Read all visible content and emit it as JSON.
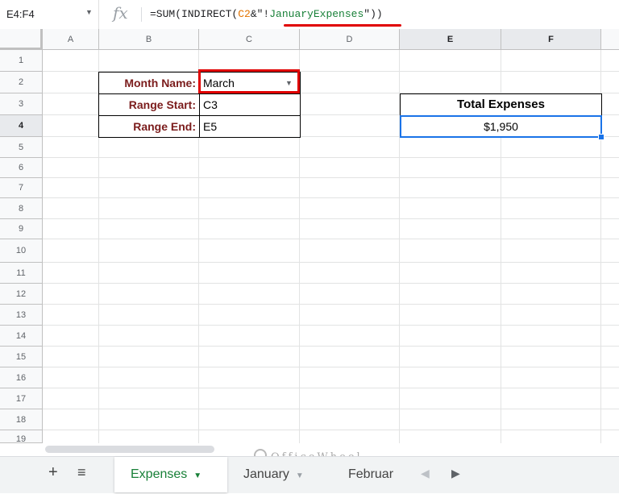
{
  "formula_bar": {
    "name_box": "E4:F4",
    "fx": "fx",
    "formula_prefix": "=SUM(INDIRECT(",
    "formula_ref": "C2",
    "formula_mid": "&\"!",
    "formula_str": "JanuaryExpenses",
    "formula_suffix": "\"))"
  },
  "columns": [
    "A",
    "B",
    "C",
    "D",
    "E",
    "F"
  ],
  "rows": [
    "1",
    "2",
    "3",
    "4",
    "5",
    "6",
    "7",
    "8",
    "9",
    "10",
    "11",
    "12",
    "13",
    "14",
    "15",
    "16",
    "17",
    "18",
    "19"
  ],
  "selected_columns": [
    "E",
    "F"
  ],
  "selected_row": "4",
  "table": {
    "month_label": "Month Name:",
    "month_value": "March",
    "range_start_label": "Range Start:",
    "range_start_value": "C3",
    "range_end_label": "Range End:",
    "range_end_value": "E5"
  },
  "total": {
    "header": "Total Expenses",
    "value": "$1,950"
  },
  "sheets": {
    "add_label": "+",
    "list_label": "≡",
    "tabs": [
      {
        "label": "Expenses",
        "active": true
      },
      {
        "label": "January",
        "active": false
      },
      {
        "label": "Februar",
        "active": false
      }
    ]
  },
  "watermark": "OfficeWheel",
  "colors": {
    "accent_red": "#e00000",
    "selection_blue": "#1a73e8",
    "label_text": "#7b1c1c",
    "active_tab": "#188038"
  }
}
